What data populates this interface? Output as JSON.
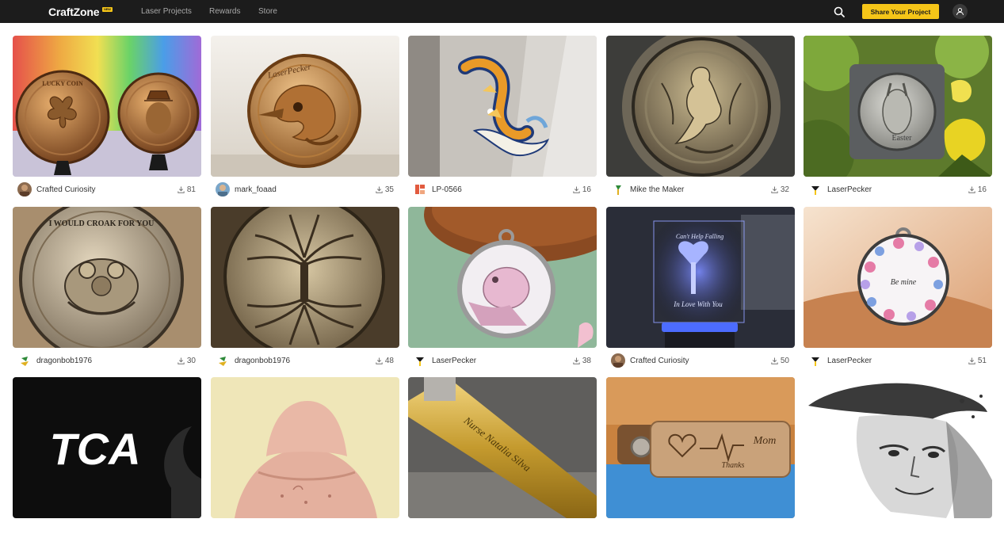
{
  "app": {
    "logo_text": "CraftZone",
    "logo_badge": "NEW"
  },
  "nav": {
    "links": [
      "Laser Projects",
      "Rewards",
      "Store"
    ],
    "share_button": "Share Your Project",
    "icons": {
      "search": "search-icon",
      "user": "user-icon"
    }
  },
  "colors": {
    "topbar": "#1c1c1c",
    "accent": "#f5c518",
    "nav_link": "#a8a8a8"
  },
  "cards": [
    {
      "author": "Crafted Curiosity",
      "downloads": "81"
    },
    {
      "author": "mark_foaad",
      "downloads": "35"
    },
    {
      "author": "LP-0566",
      "downloads": "16"
    },
    {
      "author": "Mike the Maker",
      "downloads": "32"
    },
    {
      "author": "LaserPecker",
      "downloads": "16"
    },
    {
      "author": "dragonbob1976",
      "downloads": "30"
    },
    {
      "author": "dragonbob1976",
      "downloads": "48"
    },
    {
      "author": "LaserPecker",
      "downloads": "38"
    },
    {
      "author": "Crafted Curiosity",
      "downloads": "50"
    },
    {
      "author": "LaserPecker",
      "downloads": "51"
    },
    {
      "author": "",
      "downloads": ""
    },
    {
      "author": "",
      "downloads": ""
    },
    {
      "author": "",
      "downloads": ""
    },
    {
      "author": "",
      "downloads": ""
    },
    {
      "author": "",
      "downloads": ""
    }
  ],
  "image_text": {
    "coin_lucky": "LUCKY COIN",
    "coin_laserpecker": "LaserPecker",
    "coin_easter": "Easter",
    "coin_frog": "I WOULD CROAK FOR YOU",
    "acrylic_top": "Can't Help Falling",
    "acrylic_bottom": "In Love With You",
    "tag_be_mine": "Be mine",
    "tca_logo": "TCA",
    "pen_engraving": "Nurse Natalia Silva",
    "keychain_mom": "Mom",
    "keychain_thanks": "Thanks"
  }
}
